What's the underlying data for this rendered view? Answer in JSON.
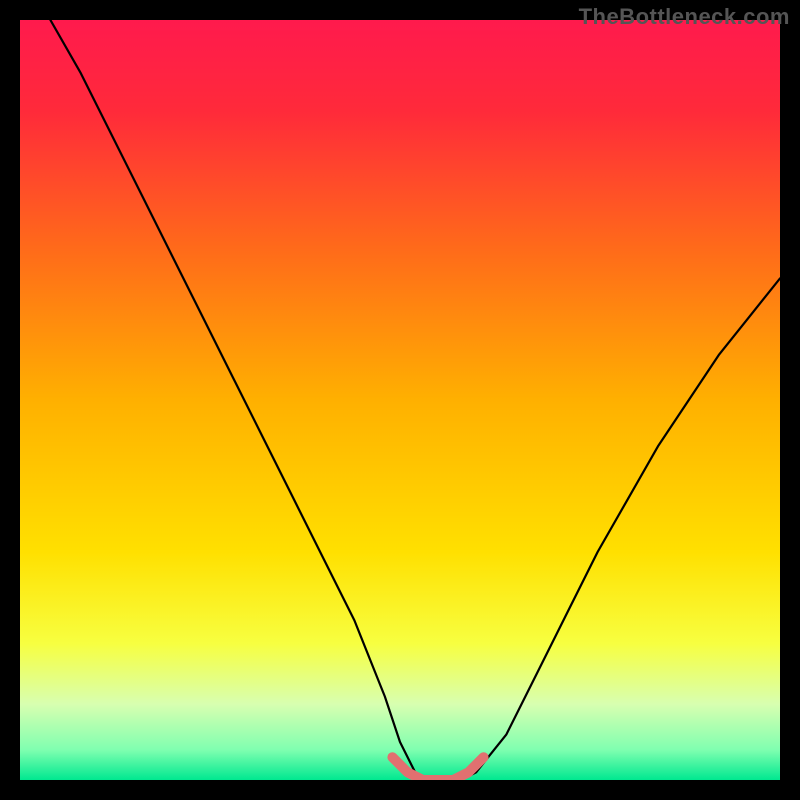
{
  "watermark": "TheBottleneck.com",
  "colors": {
    "frame": "#000000",
    "gradient_stops": [
      {
        "offset": 0.0,
        "color": "#ff1a4d"
      },
      {
        "offset": 0.12,
        "color": "#ff2a3a"
      },
      {
        "offset": 0.3,
        "color": "#ff6a1a"
      },
      {
        "offset": 0.5,
        "color": "#ffb000"
      },
      {
        "offset": 0.7,
        "color": "#ffe000"
      },
      {
        "offset": 0.82,
        "color": "#f7ff40"
      },
      {
        "offset": 0.9,
        "color": "#d8ffb0"
      },
      {
        "offset": 0.96,
        "color": "#80ffb0"
      },
      {
        "offset": 1.0,
        "color": "#00e890"
      }
    ],
    "curve": "#000000",
    "segment": "#e17070"
  },
  "chart_data": {
    "type": "line",
    "title": "",
    "xlabel": "",
    "ylabel": "",
    "xlim": [
      0,
      100
    ],
    "ylim": [
      0,
      100
    ],
    "grid": false,
    "legend": false,
    "series": [
      {
        "name": "curve",
        "x": [
          4,
          8,
          12,
          16,
          20,
          24,
          28,
          32,
          36,
          40,
          44,
          48,
          50,
          52,
          54,
          56,
          58,
          60,
          64,
          68,
          72,
          76,
          80,
          84,
          88,
          92,
          96,
          100
        ],
        "y": [
          100,
          93,
          85,
          77,
          69,
          61,
          53,
          45,
          37,
          29,
          21,
          11,
          5,
          1,
          0,
          0,
          0,
          1,
          6,
          14,
          22,
          30,
          37,
          44,
          50,
          56,
          61,
          66
        ]
      }
    ],
    "highlight_segment": {
      "x": [
        49,
        51,
        53,
        55,
        57,
        59,
        61
      ],
      "y": [
        3,
        1,
        0,
        0,
        0,
        1,
        3
      ]
    }
  }
}
